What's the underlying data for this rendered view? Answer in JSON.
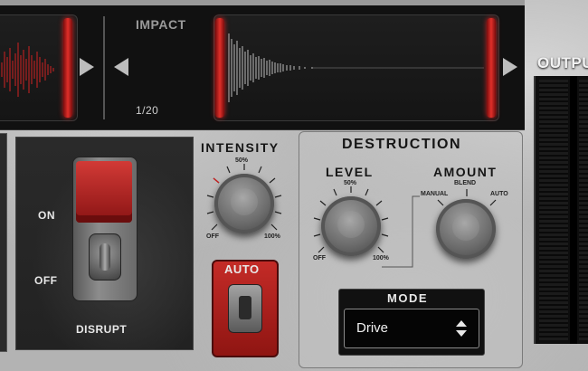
{
  "top": {
    "slot_title": "IMPACT",
    "slot_counter": "1/20"
  },
  "disrupt": {
    "on_label": "ON",
    "off_label": "OFF",
    "title": "DISRUPT",
    "state": "off"
  },
  "intensity": {
    "title": "INTENSITY",
    "tick_min": "OFF",
    "tick_mid": "50%",
    "tick_max": "100%",
    "auto_label": "AUTO"
  },
  "destruction": {
    "title": "DESTRUCTION",
    "level": {
      "title": "LEVEL",
      "tick_min": "OFF",
      "tick_mid": "50%",
      "tick_max": "100%"
    },
    "amount": {
      "title": "AMOUNT",
      "opt_manual": "MANUAL",
      "opt_blend": "BLEND",
      "opt_auto": "AUTO"
    },
    "mode": {
      "title": "MODE",
      "value": "Drive"
    }
  },
  "output": {
    "title": "OUTPU"
  },
  "colors": {
    "accent_red": "#d23a36",
    "panel_dark": "#111111"
  }
}
